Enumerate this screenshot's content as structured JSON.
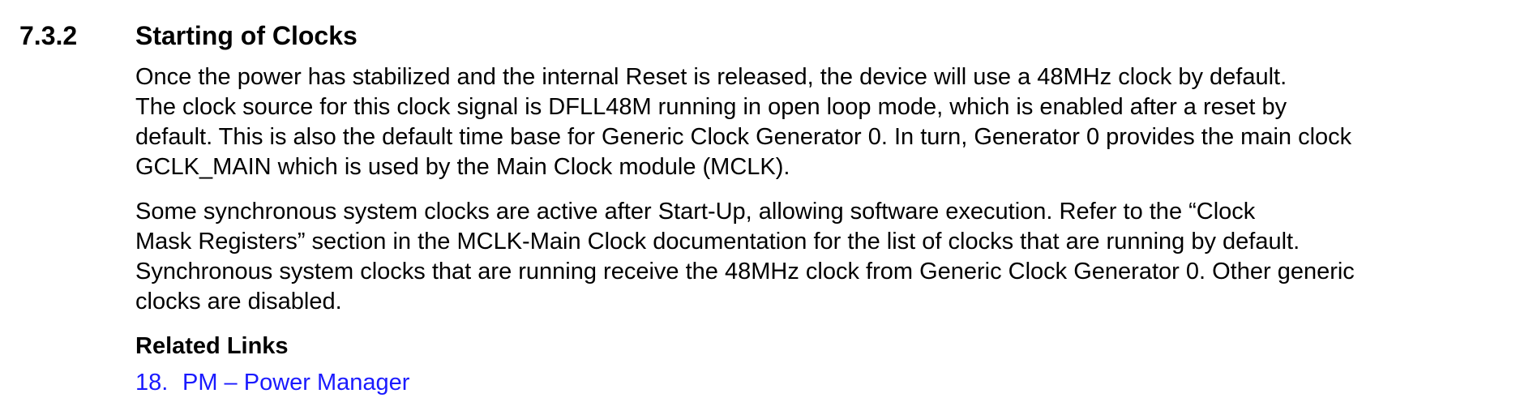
{
  "section": {
    "number": "7.3.2",
    "title": "Starting of Clocks"
  },
  "paragraphs": [
    {
      "lines": [
        "Once the power has stabilized and the internal Reset is released, the device will use a 48MHz clock by default.",
        "The clock source for this clock signal is DFLL48M running in open loop mode, which is enabled after a reset by",
        "default. This is also the default time base for Generic Clock Generator 0. In turn, Generator 0 provides the main clock",
        "GCLK_MAIN which is used by the Main Clock module (MCLK)."
      ]
    },
    {
      "lines": [
        "Some synchronous system clocks are active after Start-Up, allowing software execution. Refer to the “Clock",
        "Mask Registers” section in the MCLK-Main Clock documentation for the list of clocks that are running by default.",
        "Synchronous system clocks that are running receive the 48MHz clock from Generic Clock Generator 0. Other generic",
        "clocks are disabled."
      ]
    }
  ],
  "related_links": {
    "heading": "Related Links",
    "items": [
      {
        "number": "18.",
        "label": "PM – Power Manager"
      }
    ]
  },
  "colors": {
    "link": "#1a1aff",
    "text": "#000000"
  }
}
